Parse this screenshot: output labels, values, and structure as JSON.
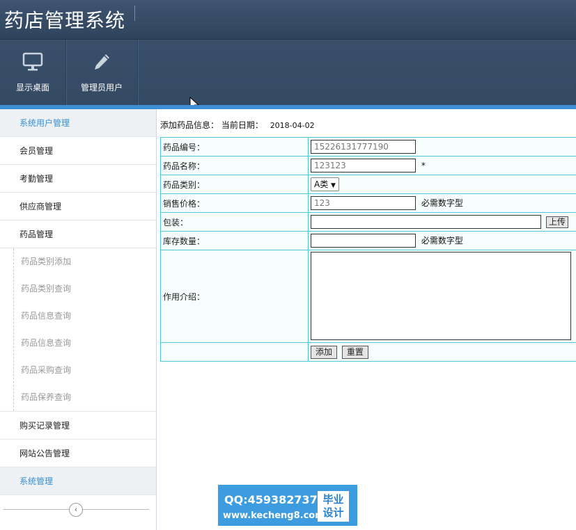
{
  "app": {
    "title": "药店管理系统"
  },
  "toolbar": {
    "items": [
      {
        "label": "显示桌面",
        "icon": "monitor-icon"
      },
      {
        "label": "管理员用户",
        "icon": "pencil-icon"
      }
    ]
  },
  "sidebar": {
    "items": [
      {
        "label": "系统用户管理",
        "active": true
      },
      {
        "label": "会员管理"
      },
      {
        "label": "考勤管理"
      },
      {
        "label": "供应商管理"
      },
      {
        "label": "药品管理",
        "expanded": true
      }
    ],
    "subitems": [
      {
        "label": "药品类别添加"
      },
      {
        "label": "药品类别查询"
      },
      {
        "label": "药品信息查询"
      },
      {
        "label": "药品信息查询"
      },
      {
        "label": "药品采购查询"
      },
      {
        "label": "药品保养查询"
      }
    ],
    "items_after": [
      {
        "label": "购买记录管理"
      },
      {
        "label": "网站公告管理"
      },
      {
        "label": "系统管理",
        "shaded": true
      }
    ],
    "collapse_icon": "chevron-left-icon"
  },
  "main": {
    "heading": "添加药品信息：",
    "date_label": "当前日期：",
    "date_value": "2018-04-02",
    "fields": {
      "code": {
        "label": "药品编号：",
        "value": "15226131777190"
      },
      "name": {
        "label": "药品名称：",
        "value": "123123",
        "required_mark": "*"
      },
      "category": {
        "label": "药品类别：",
        "selected": "A类"
      },
      "price": {
        "label": "销售价格：",
        "value": "123",
        "hint": "必需数字型"
      },
      "package": {
        "label": "包装：",
        "value": "",
        "upload_label": "上传"
      },
      "stock": {
        "label": "库存数量：",
        "value": "",
        "hint": "必需数字型"
      },
      "description": {
        "label": "作用介绍：",
        "value": ""
      }
    },
    "buttons": {
      "submit": "添加",
      "reset": "重置"
    }
  },
  "watermark": {
    "qq": "QQ:459382737",
    "site": "www.kecheng8.com",
    "badge_line1": "毕业",
    "badge_line2": "设计"
  },
  "colors": {
    "header": "#34495f",
    "accent": "#3b8fd6",
    "table_border": "#4fc6dc"
  }
}
